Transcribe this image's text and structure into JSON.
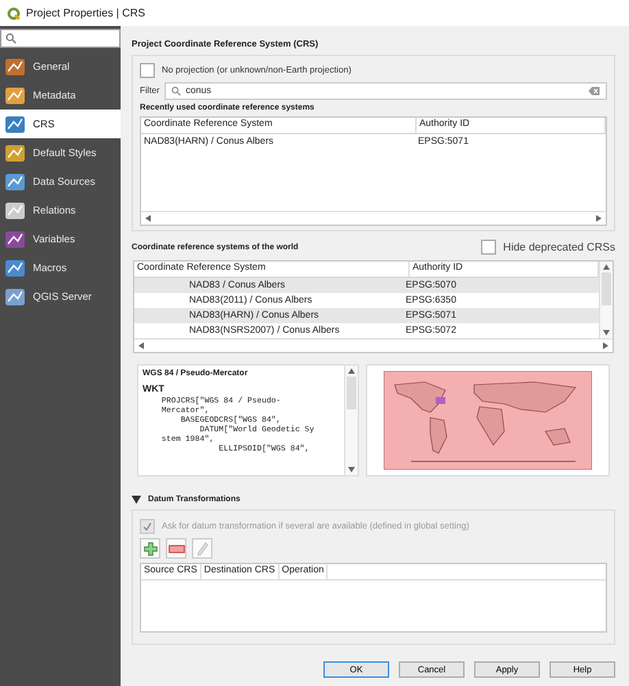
{
  "window": {
    "title": "Project Properties | CRS"
  },
  "sidebar": {
    "items": [
      {
        "label": "General",
        "selected": false
      },
      {
        "label": "Metadata",
        "selected": false
      },
      {
        "label": "CRS",
        "selected": true
      },
      {
        "label": "Default Styles",
        "selected": false
      },
      {
        "label": "Data Sources",
        "selected": false
      },
      {
        "label": "Relations",
        "selected": false
      },
      {
        "label": "Variables",
        "selected": false
      },
      {
        "label": "Macros",
        "selected": false
      },
      {
        "label": "QGIS Server",
        "selected": false
      }
    ]
  },
  "crs": {
    "title": "Project Coordinate Reference System (CRS)",
    "no_projection": {
      "label": "No projection (or unknown/non-Earth projection)",
      "checked": false
    },
    "filter": {
      "label": "Filter",
      "value": "conus"
    },
    "recent": {
      "title": "Recently used coordinate reference systems",
      "columns": [
        "Coordinate Reference System",
        "Authority ID"
      ],
      "rows": [
        {
          "name": "NAD83(HARN) / Conus Albers",
          "authority": "EPSG:5071"
        }
      ]
    },
    "world": {
      "title": "Coordinate reference systems of the world",
      "hide_deprecated": {
        "label": "Hide deprecated CRSs",
        "checked": false
      },
      "columns": [
        "Coordinate Reference System",
        "Authority ID"
      ],
      "rows": [
        {
          "name": "NAD83 / Conus Albers",
          "authority": "EPSG:5070"
        },
        {
          "name": "NAD83(2011) / Conus Albers",
          "authority": "EPSG:6350"
        },
        {
          "name": "NAD83(HARN) / Conus Albers",
          "authority": "EPSG:5071"
        },
        {
          "name": "NAD83(NSRS2007) / Conus Albers",
          "authority": "EPSG:5072"
        }
      ]
    },
    "details": {
      "name": "WGS 84 / Pseudo-Mercator",
      "heading": "WKT",
      "wkt": "    PROJCRS[\"WGS 84 / Pseudo-\n    Mercator\",\n        BASEGEODCRS[\"WGS 84\",\n            DATUM[\"World Geodetic Sy\n    stem 1984\",\n                ELLIPSOID[\"WGS 84\","
    }
  },
  "datum": {
    "title": "Datum Transformations",
    "expanded": true,
    "ask": {
      "label": "Ask for datum transformation if several are available (defined in global setting)",
      "checked": true,
      "disabled": true
    },
    "columns": [
      "Source CRS",
      "Destination CRS",
      "Operation"
    ]
  },
  "buttons": [
    {
      "label": "OK",
      "default": true
    },
    {
      "label": "Cancel",
      "default": false
    },
    {
      "label": "Apply",
      "default": false
    },
    {
      "label": "Help",
      "default": false
    }
  ]
}
